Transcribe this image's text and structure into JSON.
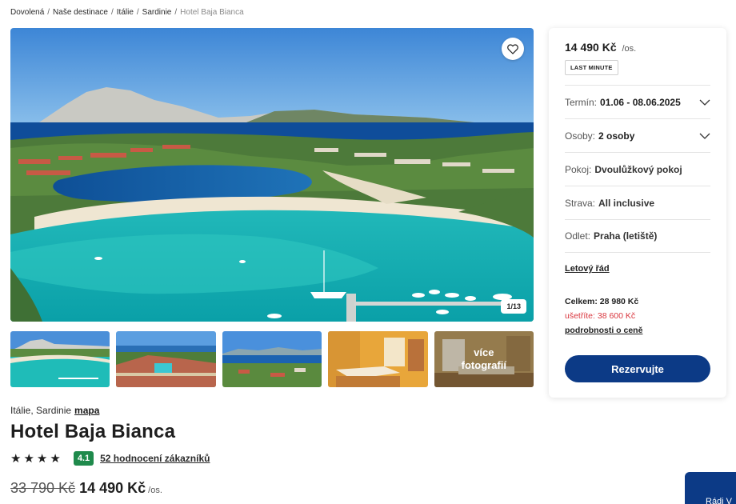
{
  "breadcrumb": {
    "items": [
      "Dovolená",
      "Naše destinace",
      "Itálie",
      "Sardinie"
    ],
    "current": "Hotel Baja Bianca"
  },
  "gallery": {
    "counter": "1/13",
    "more_label_line1": "více",
    "more_label_line2": "fotografií",
    "favorite_icon": "heart-icon"
  },
  "hotel": {
    "location": "Itálie, Sardinie",
    "map_link": "mapa",
    "name": "Hotel Baja Bianca",
    "stars": 4,
    "star_glyph": "★",
    "score": "4.1",
    "reviews_link": "52 hodnocení zákazníků",
    "price_old": "33 790 Kč",
    "price_new": "14 490 Kč",
    "per_person": "/os."
  },
  "booking": {
    "price": "14 490 Kč",
    "per_person": "/os.",
    "badge": "LAST MINUTE",
    "term_label": "Termín:",
    "term_value": "01.06 - 08.06.2025",
    "persons_label": "Osoby:",
    "persons_value": "2 osoby",
    "room_label": "Pokoj:",
    "room_value": "Dvoulůžkový pokoj",
    "board_label": "Strava:",
    "board_value": "All inclusive",
    "departure_label": "Odlet:",
    "departure_value": "Praha (letiště)",
    "flight_link": "Letový řád",
    "total": "Celkem: 28 980 Kč",
    "savings": "ušetříte: 38 600 Kč",
    "price_details_link": "podrobnosti o ceně",
    "reserve_button": "Rezervujte"
  },
  "chat": {
    "label": "Rádi V"
  },
  "colors": {
    "primary": "#0c3a86",
    "score_green": "#1f8a4c",
    "savings_red": "#d9363e"
  }
}
